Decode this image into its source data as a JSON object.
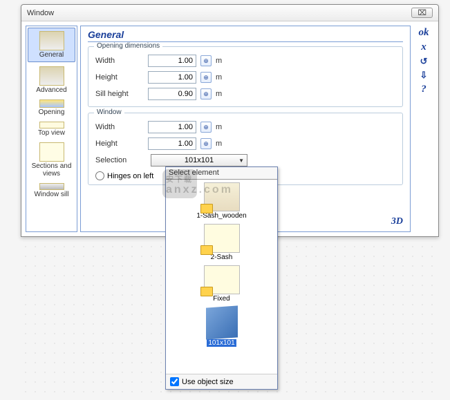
{
  "window": {
    "title": "Window",
    "close_glyph": "⌧"
  },
  "sidebar": {
    "items": [
      {
        "label": "General"
      },
      {
        "label": "Advanced"
      },
      {
        "label": "Opening"
      },
      {
        "label": "Top view"
      },
      {
        "label": "Sections and views"
      },
      {
        "label": "Window sill"
      }
    ]
  },
  "main": {
    "title": "General",
    "group1": {
      "title": "Opening dimensions",
      "width_label": "Width",
      "width_value": "1.00",
      "width_unit": "m",
      "height_label": "Height",
      "height_value": "1.00",
      "height_unit": "m",
      "sill_label": "Sill height",
      "sill_value": "0.90",
      "sill_unit": "m"
    },
    "group2": {
      "title": "Window",
      "width_label": "Width",
      "width_value": "1.00",
      "width_unit": "m",
      "height_label": "Height",
      "height_value": "1.00",
      "height_unit": "m",
      "selection_label": "Selection",
      "selection_value": "101x101",
      "hinges_label": "Hinges on left"
    },
    "threeD": "3D"
  },
  "actions": {
    "ok": "ok",
    "cancel": "x",
    "a1": "↺",
    "a2": "⇩",
    "help": "?"
  },
  "dropdown": {
    "title": "Select element",
    "items": [
      {
        "label": "1-Sash_wooden"
      },
      {
        "label": "2-Sash"
      },
      {
        "label": "Fixed"
      },
      {
        "label": "101x101"
      }
    ],
    "use_size_label": "Use object size",
    "use_size_checked": true
  },
  "watermark": {
    "big": "安下载",
    "small": "anxz.com"
  },
  "spin_glyph": "⊕"
}
